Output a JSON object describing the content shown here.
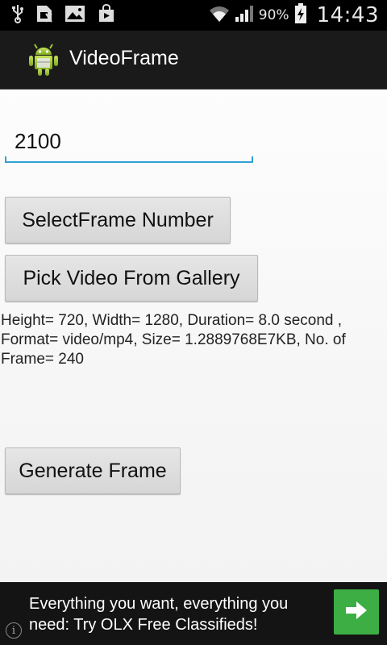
{
  "status_bar": {
    "battery_percent": "90%",
    "time": "14:43",
    "icons": [
      "usb-icon",
      "sim-icon",
      "image-icon",
      "store-icon",
      "wifi-icon",
      "signal-icon",
      "battery-charging-icon"
    ]
  },
  "action_bar": {
    "app_icon": "android-icon",
    "title": "VideoFrame"
  },
  "frame_input": {
    "value": "2100"
  },
  "buttons": {
    "select_frame": "SelectFrame Number",
    "pick_video": "Pick Video From Gallery",
    "generate_frame": "Generate Frame"
  },
  "video_info": "Height= 720, Width= 1280, Duration= 8.0 second , Format= video/mp4, Size= 1.2889768E7KB, No. of Frame= 240",
  "ad_banner": {
    "text": "Everything you want, everything you need: Try OLX Free Classifieds!",
    "go_icon": "arrow-right-icon",
    "info_icon": "info-icon",
    "info_glyph": "i"
  },
  "colors": {
    "accent": "#33a0d3",
    "ad_button": "#3cae43",
    "action_bar": "#1a1a1a"
  }
}
